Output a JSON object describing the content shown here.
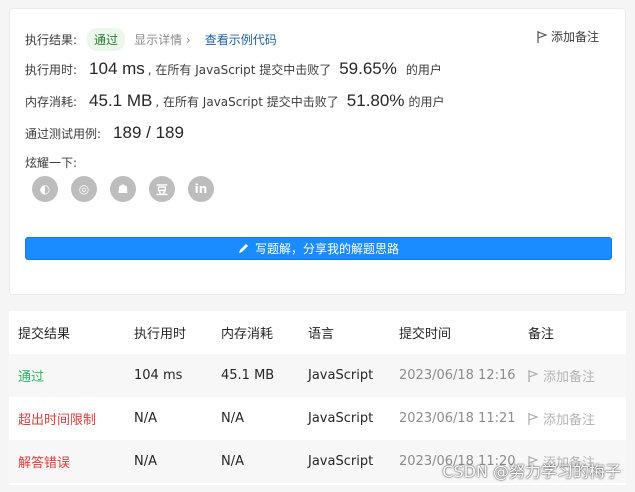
{
  "result_card": {
    "result_label": "执行结果:",
    "result_status": "通过",
    "show_details": "显示详情 ›",
    "view_sample": "查看示例代码",
    "add_note": "添加备注",
    "runtime_label": "执行用时:",
    "runtime_value": "104 ms",
    "runtime_text1": ", 在所有 JavaScript 提交中击败了",
    "runtime_percent": "59.65%",
    "runtime_text2": "的用户",
    "memory_label": "内存消耗:",
    "memory_value": "45.1 MB",
    "memory_text1": ", 在所有 JavaScript 提交中击败了",
    "memory_percent": "51.80%",
    "memory_text2": "的用户",
    "tests_label": "通过测试用例:",
    "tests_value": "189 / 189",
    "share_label": "炫耀一下:",
    "socials": [
      {
        "icon": "wechat-icon",
        "glyph": "◐"
      },
      {
        "icon": "weibo-icon",
        "glyph": "◎"
      },
      {
        "icon": "qq-icon",
        "glyph": "☗"
      },
      {
        "icon": "douban-icon",
        "glyph": "豆"
      },
      {
        "icon": "linkedin-icon",
        "glyph": "in"
      }
    ],
    "share_button": "写题解，分享我的解题思路"
  },
  "submissions": {
    "headers": [
      "提交结果",
      "执行用时",
      "内存消耗",
      "语言",
      "提交时间",
      "备注"
    ],
    "rows": [
      {
        "status": "通过",
        "runtime": "104 ms",
        "memory": "45.1 MB",
        "lang": "JavaScript",
        "time": "2023/06/18 12:16",
        "note": "添加备注",
        "status_color": "#2db55d"
      },
      {
        "status": "超出时间限制",
        "runtime": "N/A",
        "memory": "N/A",
        "lang": "JavaScript",
        "time": "2023/06/18 11:21",
        "note": "添加备注",
        "status_color": "#e23b3b"
      },
      {
        "status": "解答错误",
        "runtime": "N/A",
        "memory": "N/A",
        "lang": "JavaScript",
        "time": "2023/06/18 11:20",
        "note": "添加备注",
        "status_color": "#e23b3b"
      }
    ]
  },
  "watermark": "CSDN @努力学习的梅子"
}
